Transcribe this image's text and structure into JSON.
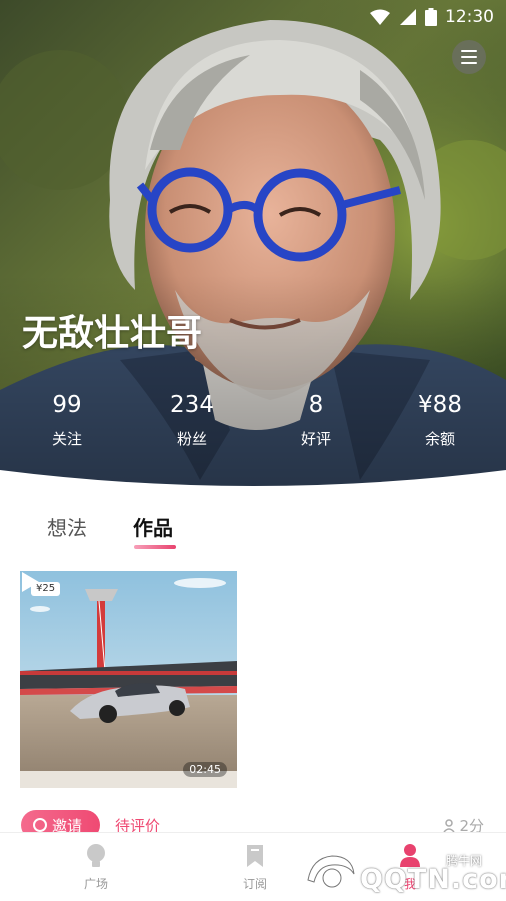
{
  "status_bar": {
    "time": "12:30"
  },
  "profile": {
    "name": "无敌壮壮哥",
    "stats": [
      {
        "value": "99",
        "label": "关注"
      },
      {
        "value": "234",
        "label": "粉丝"
      },
      {
        "value": "8",
        "label": "好评"
      },
      {
        "value": "¥88",
        "label": "余额"
      }
    ]
  },
  "tabs": [
    {
      "label": "想法",
      "active": false
    },
    {
      "label": "作品",
      "active": true
    }
  ],
  "works": [
    {
      "price": "¥25",
      "duration": "02:45",
      "invite_label": "邀请",
      "status": "待评价",
      "score": "2分"
    }
  ],
  "bottom_nav": [
    {
      "label": "广场",
      "icon": "bulb-icon",
      "active": false
    },
    {
      "label": "订阅",
      "icon": "bookmark-icon",
      "active": false
    },
    {
      "label": "",
      "icon": "add-icon",
      "active": false
    },
    {
      "label": "我",
      "icon": "profile-icon",
      "active": true
    }
  ],
  "watermark": {
    "text": "QQTN.com",
    "small": "腾牛网"
  },
  "colors": {
    "accent": "#e8426e",
    "accent_light": "#f7a0b9"
  }
}
